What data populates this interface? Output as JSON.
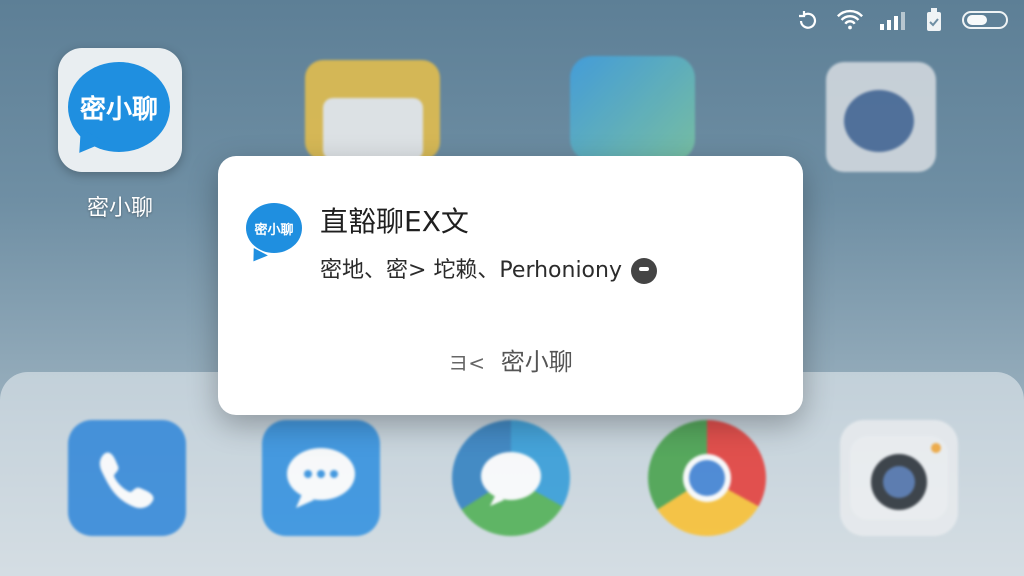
{
  "status_bar": {
    "icons": [
      "rotate-icon",
      "wifi-icon",
      "signal-icon",
      "battery-saver-icon",
      "battery-icon"
    ]
  },
  "home": {
    "apps": [
      {
        "name": "密小聊",
        "label": "密小聊",
        "tile_text": "密小聊",
        "color": "#1f8fe0"
      }
    ]
  },
  "notification": {
    "app_icon_text": "密小聊",
    "title": "直豁聊EX文",
    "body": "密地、密> 坨赖、Perhoniony",
    "footer_arrow": "ヨ<",
    "footer_app": "密小聊"
  },
  "dock": {
    "apps": [
      "phone-icon",
      "messages-icon",
      "chat-icon",
      "chrome-icon",
      "camera-icon"
    ]
  },
  "colors": {
    "wallpaper_top": "#5d7f96",
    "wallpaper_bottom": "#b9c6cf",
    "app_blue": "#1f8fe0",
    "card_bg": "#ffffff"
  }
}
